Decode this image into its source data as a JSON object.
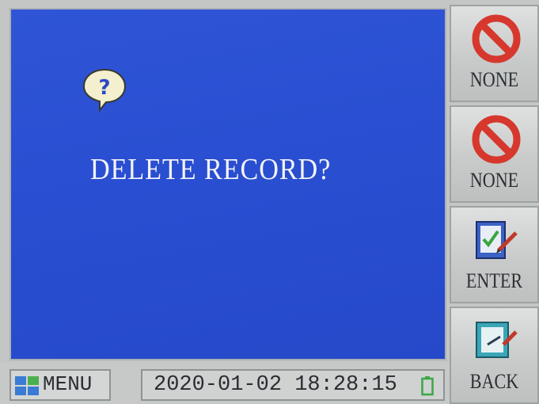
{
  "dialog": {
    "prompt": "DELETE RECORD?",
    "icon": "question-bubble-icon"
  },
  "side_buttons": [
    {
      "label": "NONE",
      "icon": "prohibited-icon"
    },
    {
      "label": "NONE",
      "icon": "prohibited-icon"
    },
    {
      "label": "ENTER",
      "icon": "enter-check-icon"
    },
    {
      "label": "BACK",
      "icon": "back-icon"
    }
  ],
  "status_bar": {
    "menu_label": "MENU",
    "datetime": "2020-01-02 18:28:15",
    "battery_icon": "battery-icon"
  },
  "colors": {
    "dialog_bg": "#2a4fd2",
    "prompt_text": "#f2f3f5",
    "panel_bg": "#c9cccb",
    "prohibited_red": "#d6382d",
    "battery_green": "#3aa845"
  }
}
